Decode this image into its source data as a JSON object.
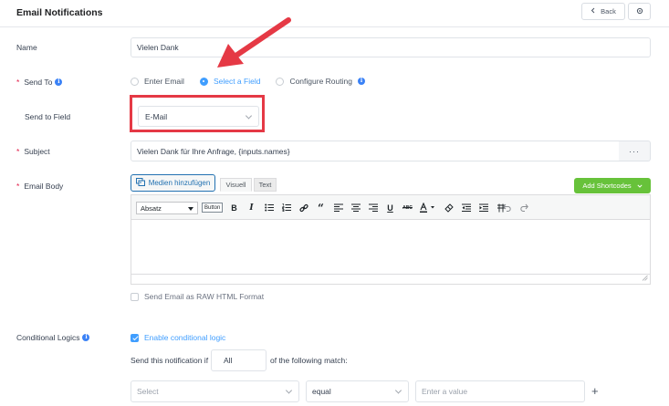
{
  "header": {
    "title": "Email Notifications",
    "back_label": "Back",
    "settings_icon": "gear-icon"
  },
  "form": {
    "name": {
      "label": "Name",
      "value": "Vielen Dank"
    },
    "send_to": {
      "label": "Send To",
      "required": "*",
      "options": [
        {
          "label": "Enter Email",
          "selected": false
        },
        {
          "label": "Select a Field",
          "selected": true
        },
        {
          "label": "Configure Routing",
          "selected": false
        }
      ]
    },
    "send_to_field": {
      "label": "Send to Field",
      "value": "E-Mail"
    },
    "subject": {
      "label": "Subject",
      "required": "*",
      "value": "Vielen Dank für Ihre Anfrage, {inputs.names}",
      "more_label": "···"
    },
    "email_body": {
      "label": "Email Body",
      "required": "*",
      "media_button": "Medien hinzufügen",
      "tab_visual": "Visuell",
      "tab_text": "Text",
      "shortcodes_button": "Add Shortcodes",
      "format_select": "Absatz",
      "mini_button": "Button",
      "raw_html_label": "Send Email as RAW HTML Format"
    },
    "conditional": {
      "label": "Conditional Logics",
      "enable_label": "Enable conditional logic",
      "enabled": true,
      "sentence_prefix": "Send this notification if",
      "match_value": "All",
      "sentence_suffix": "of the following match:",
      "field_placeholder": "Select",
      "operator_value": "equal",
      "value_placeholder": "Enter a value",
      "add_label": "+"
    }
  },
  "colors": {
    "accent": "#409eff",
    "annotation_red": "#e53945",
    "shortcodes_green": "#67c23a",
    "required": "#e11d48"
  }
}
